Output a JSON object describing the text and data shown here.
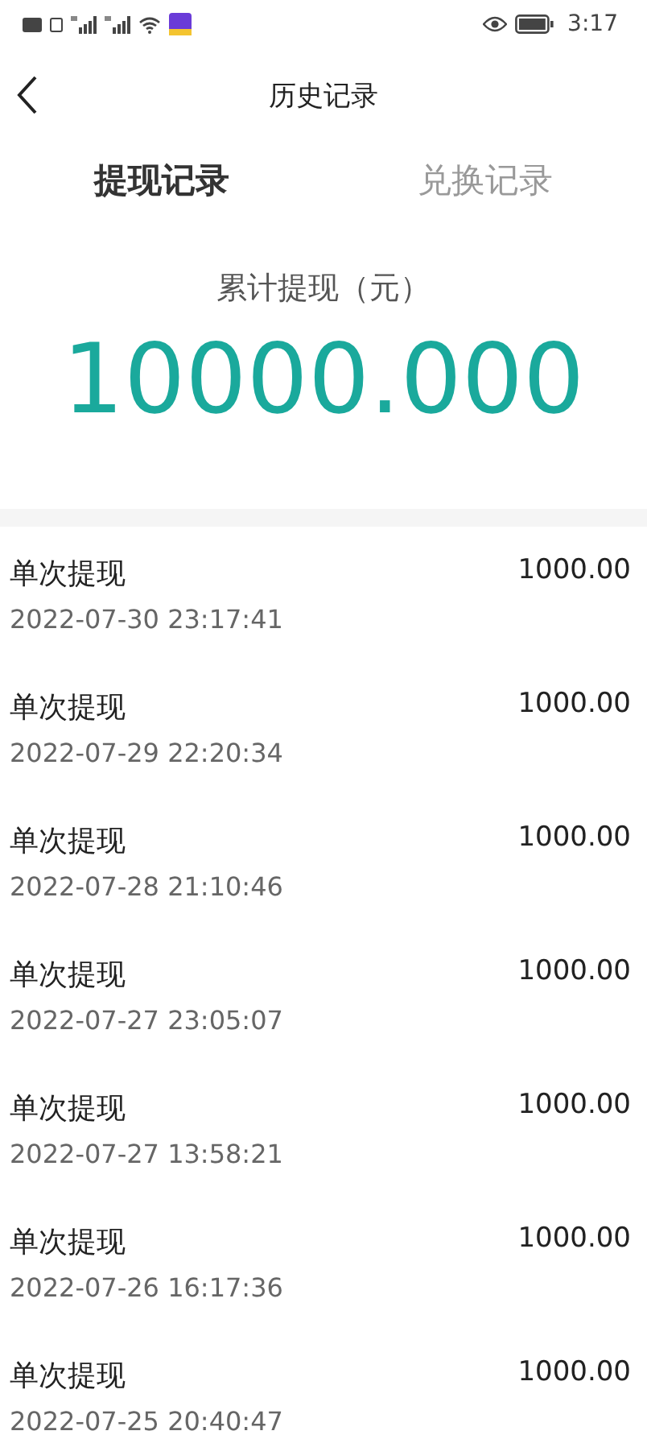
{
  "status_bar": {
    "time": "3:17"
  },
  "nav": {
    "title": "历史记录"
  },
  "tabs": [
    {
      "label": "提现记录",
      "selected": true
    },
    {
      "label": "兑换记录",
      "selected": false
    }
  ],
  "summary": {
    "label": "累计提现（元）",
    "amount": "10000.000"
  },
  "records": [
    {
      "title": "单次提现",
      "time": "2022-07-30 23:17:41",
      "amount": "1000.00"
    },
    {
      "title": "单次提现",
      "time": "2022-07-29 22:20:34",
      "amount": "1000.00"
    },
    {
      "title": "单次提现",
      "time": "2022-07-28 21:10:46",
      "amount": "1000.00"
    },
    {
      "title": "单次提现",
      "time": "2022-07-27 23:05:07",
      "amount": "1000.00"
    },
    {
      "title": "单次提现",
      "time": "2022-07-27 13:58:21",
      "amount": "1000.00"
    },
    {
      "title": "单次提现",
      "time": "2022-07-26 16:17:36",
      "amount": "1000.00"
    },
    {
      "title": "单次提现",
      "time": "2022-07-25 20:40:47",
      "amount": "1000.00"
    }
  ]
}
